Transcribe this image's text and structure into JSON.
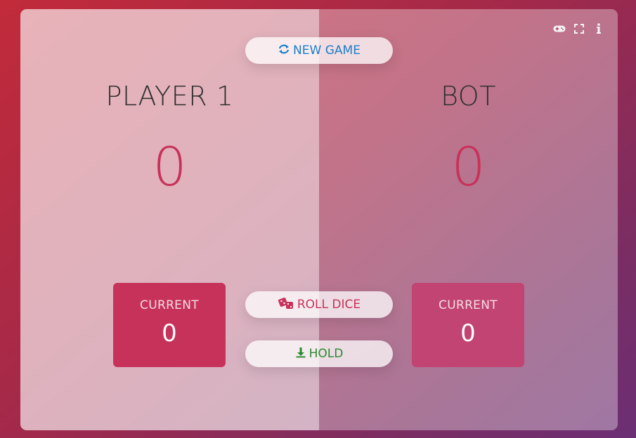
{
  "players": [
    {
      "name": "PLAYER 1",
      "score": "0",
      "current_label": "CURRENT",
      "current_score": "0"
    },
    {
      "name": "BOT",
      "score": "0",
      "current_label": "CURRENT",
      "current_score": "0"
    }
  ],
  "buttons": {
    "new_game": "NEW GAME",
    "roll_dice": "ROLL DICE",
    "hold": "HOLD"
  },
  "top_icons": [
    "gamepad-icon",
    "fullscreen-icon",
    "info-icon"
  ],
  "colors": {
    "accent": "#c7325a",
    "new_game": "#1d7dc9",
    "hold": "#2a8a2f"
  }
}
